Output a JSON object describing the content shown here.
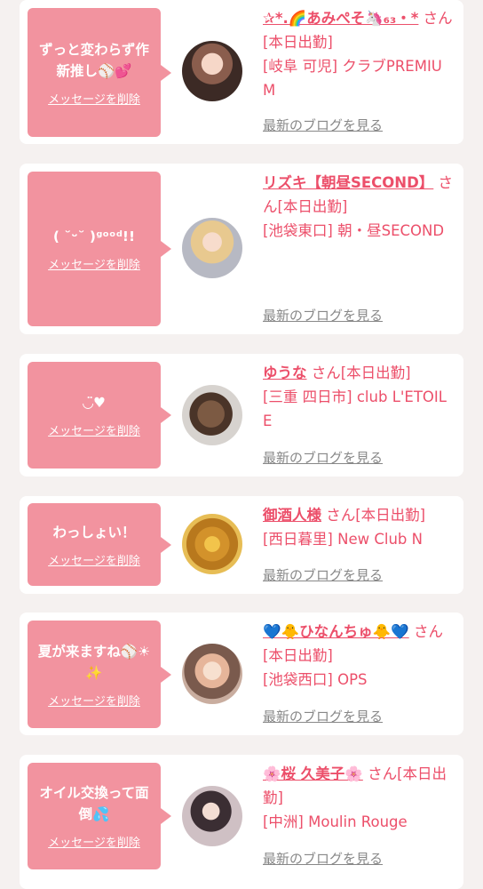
{
  "common": {
    "delete_label": "メッセージを削除",
    "blog_label": "最新のブログを見る"
  },
  "cards": [
    {
      "message": "ずっと変わらず作新推し⚾💕",
      "name": "✰*.🌈あみぺそ🦄₆₃・*",
      "suffix": "さん[本日出勤]",
      "shop": "[岐阜 可児] クラブPREMIUM"
    },
    {
      "message": "( ˘ᵕ˘ )ᵍᵒᵒᵈ!!",
      "name": "リズキ【朝昼SECOND】",
      "suffix": "さん[本日出勤]",
      "shop": "[池袋東口] 朝・昼SECOND"
    },
    {
      "message": "◡̈♥",
      "name": "ゆうな",
      "suffix": "さん[本日出勤]",
      "shop": "[三重 四日市] club L'ETOILE"
    },
    {
      "message": "わっしょい！",
      "name": "御酒人様",
      "suffix": "さん[本日出勤]",
      "shop": "[西日暮里] New Club N"
    },
    {
      "message": "夏が来ますね⚾☀\n✨",
      "name": "💙🐥ひなんちゅ🐥💙",
      "suffix": "さん[本日出勤]",
      "shop": "[池袋西口] OPS"
    },
    {
      "message": "オイル交換って面倒💦",
      "name": "🌸桜 久美子🌸",
      "suffix": "さん[本日出勤]",
      "shop": "[中洲] Moulin Rouge"
    }
  ]
}
